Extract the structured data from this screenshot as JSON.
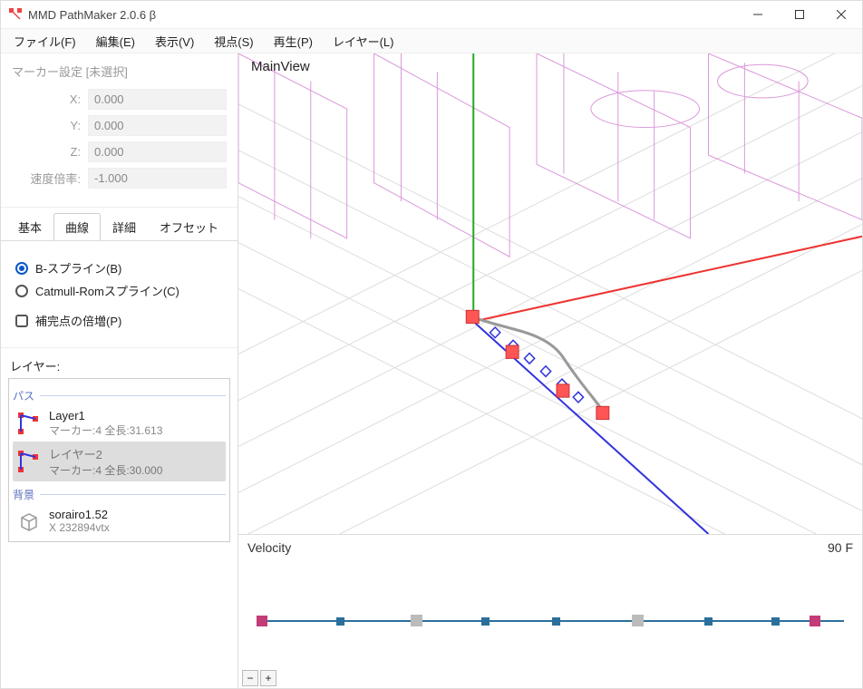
{
  "app": {
    "title": "MMD PathMaker 2.0.6 β"
  },
  "menu": {
    "file": "ファイル(F)",
    "edit": "編集(E)",
    "view": "表示(V)",
    "camera": "視点(S)",
    "play": "再生(P)",
    "layer": "レイヤー(L)"
  },
  "marker": {
    "title": "マーカー設定 [未選択]",
    "x_label": "X:",
    "y_label": "Y:",
    "z_label": "Z:",
    "rate_label": "速度倍率:",
    "x": "0.000",
    "y": "0.000",
    "z": "0.000",
    "rate": "-1.000"
  },
  "tabs": {
    "basic": "基本",
    "curve": "曲線",
    "detail": "詳細",
    "offset": "オフセット"
  },
  "curve": {
    "bspline": "B-スプライン(B)",
    "catmull": "Catmull-Romスプライン(C)",
    "densify": "補完点の倍増(P)"
  },
  "layers": {
    "heading": "レイヤー:",
    "path_group": "パス",
    "bg_group": "背景",
    "items": [
      {
        "name": "Layer1",
        "meta": "マーカー:4 全長:31.613"
      },
      {
        "name": "レイヤー2",
        "meta": "マーカー:4 全長:30.000"
      }
    ],
    "bg": {
      "name": "sorairo1.52",
      "meta": "X 232894vtx"
    }
  },
  "viewport": {
    "label": "MainView"
  },
  "velocity": {
    "label": "Velocity",
    "frames": "90 F",
    "minus": "−",
    "plus": "+"
  }
}
